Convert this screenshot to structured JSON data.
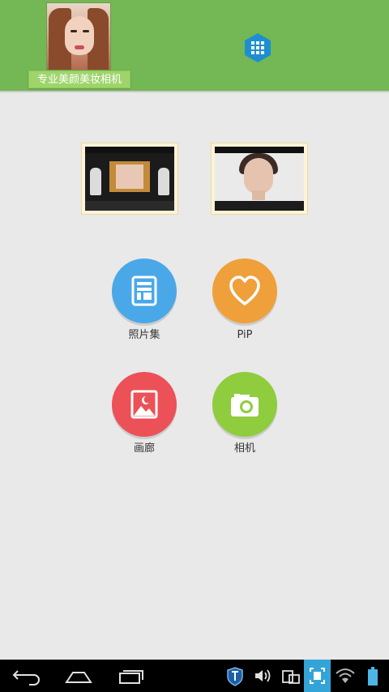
{
  "header": {
    "brand_label": "专业美颜美妆相机",
    "avatar_icon": "portrait-photo",
    "menu_icon": "grid-icon"
  },
  "tiles": [
    {
      "label": "照片集",
      "icon": "album-icon",
      "color": "#4aa8e8"
    },
    {
      "label": "PiP",
      "icon": "heart-icon",
      "color": "#f0a03a"
    },
    {
      "label": "画廊",
      "icon": "gallery-icon",
      "color": "#ec5157"
    },
    {
      "label": "相机",
      "icon": "camera-icon",
      "color": "#8fcc3e"
    }
  ],
  "colors": {
    "header_bg": "#74b755",
    "page_bg": "#e9e9e9",
    "capture_highlight": "#34a4d8"
  }
}
